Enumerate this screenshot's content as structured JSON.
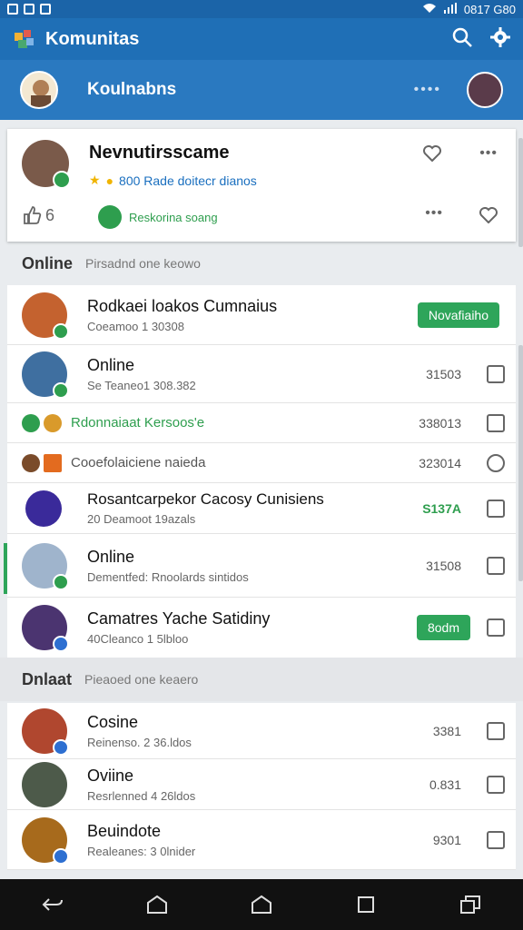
{
  "statusbar": {
    "time": "0817 G80"
  },
  "appbar": {
    "title": "Komunitas"
  },
  "profile_bar": {
    "name": "Koulnabns",
    "dots": "••••"
  },
  "card": {
    "name": "Nevnutirsscame",
    "meta": "800 Rade doitecr dianos",
    "like_count": "6",
    "status": "Reskorina soang"
  },
  "sections": [
    {
      "heading": "Online",
      "sub": "Pirsadnd one keowo"
    },
    {
      "heading": "Dnlaat",
      "sub": "Pieaoed one keaero"
    }
  ],
  "online_list": [
    {
      "title": "Rodkaei loakos Cumnaius",
      "subtitle": "Coeamoo 1 30308",
      "pill": "Novafiaiho"
    },
    {
      "title": "Online",
      "subtitle": "Se Teaneo1 308.382",
      "value": "31503"
    },
    {
      "text": "Rdonnaiaat Kersoos'e",
      "value": "338013"
    },
    {
      "text": "Cooefolaiciene naieda",
      "value": "323014"
    },
    {
      "title": "Rosantcarpekor Cacosy Cunisiens",
      "subtitle": "20 Deamoot 19azals",
      "value": "S137A"
    },
    {
      "title": "Online",
      "subtitle": "Dementfed: Rnoolards sintidos",
      "value": "31508"
    },
    {
      "title": "Camatres Yache Satidiny",
      "subtitle": "40Cleanco 1 5lbloo",
      "pill": "8odm"
    }
  ],
  "offline_list": [
    {
      "title": "Cosine",
      "subtitle": "Reinenso. 2 36.ldos",
      "value": "3381"
    },
    {
      "title": "Oviine",
      "subtitle": "Resrlenned 4 26ldos",
      "value": "0.831"
    },
    {
      "title": "Beuindote",
      "subtitle": "Realeanes: 3 0lnider",
      "value": "9301"
    }
  ]
}
